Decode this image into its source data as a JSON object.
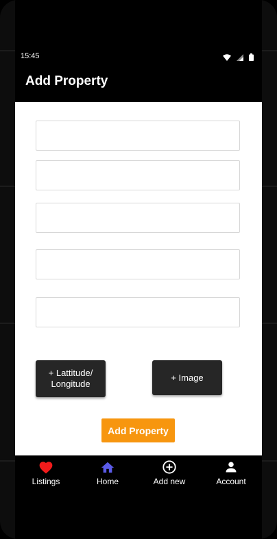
{
  "status_bar": {
    "time": "15:45",
    "icons": [
      "wifi-icon",
      "signal-icon",
      "battery-icon"
    ]
  },
  "app_bar": {
    "title": "Add Property"
  },
  "form": {
    "fields": [
      {
        "value": "",
        "placeholder": ""
      },
      {
        "value": "",
        "placeholder": ""
      },
      {
        "value": "",
        "placeholder": ""
      },
      {
        "value": "",
        "placeholder": ""
      },
      {
        "value": "",
        "placeholder": ""
      }
    ],
    "lat_long_button_line1": "+ Lattitude/",
    "lat_long_button_line2": "Longitude",
    "image_button_label": "+ Image",
    "submit_label": "Add Property"
  },
  "bottom_nav": {
    "items": [
      {
        "label": "Listings",
        "icon": "heart-icon",
        "color": "#f21b1b"
      },
      {
        "label": "Home",
        "icon": "home-icon",
        "color": "#5b5be8"
      },
      {
        "label": "Add new",
        "icon": "add-circle-icon",
        "color": "#ffffff"
      },
      {
        "label": "Account",
        "icon": "person-icon",
        "color": "#ffffff"
      }
    ]
  },
  "colors": {
    "accent": "#f7960f",
    "dark_button": "#262626",
    "home_active": "#5b5be8",
    "heart": "#f21b1b"
  }
}
